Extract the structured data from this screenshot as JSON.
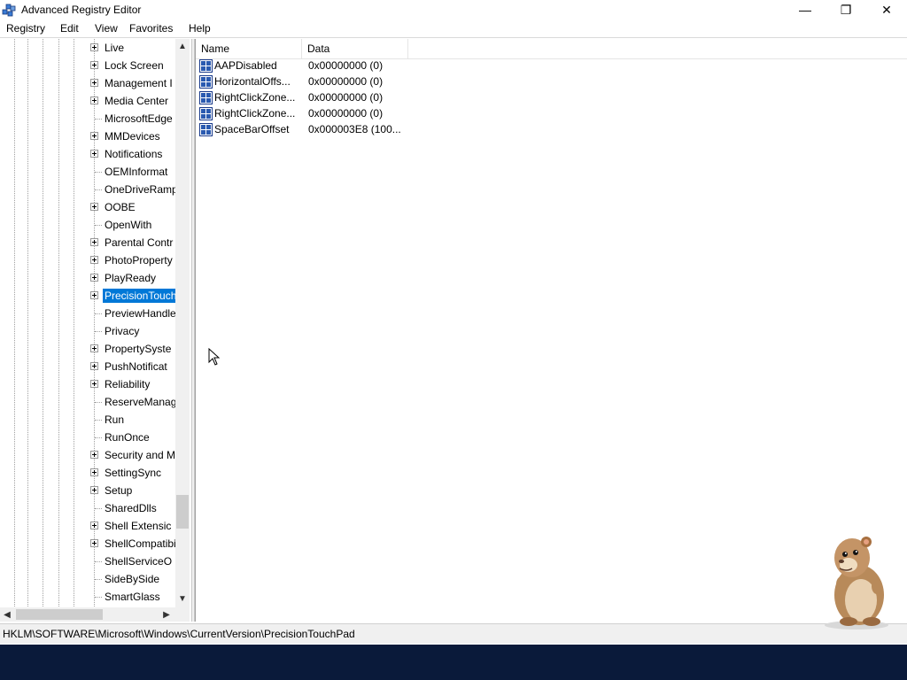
{
  "window": {
    "title": "Advanced Registry Editor",
    "controls": {
      "minimize": "—",
      "maximize": "❐",
      "close": "✕"
    }
  },
  "menu": [
    "Registry",
    "Edit",
    "View",
    "Favorites",
    "Help"
  ],
  "tree": {
    "items": [
      {
        "label": "Live",
        "expandable": true
      },
      {
        "label": "Lock Screen",
        "expandable": true
      },
      {
        "label": "Management I",
        "expandable": true
      },
      {
        "label": "Media Center",
        "expandable": true
      },
      {
        "label": "MicrosoftEdge",
        "expandable": false
      },
      {
        "label": "MMDevices",
        "expandable": true
      },
      {
        "label": "Notifications",
        "expandable": true
      },
      {
        "label": "OEMInformat",
        "expandable": false
      },
      {
        "label": "OneDriveRamp",
        "expandable": false
      },
      {
        "label": "OOBE",
        "expandable": true
      },
      {
        "label": "OpenWith",
        "expandable": false
      },
      {
        "label": "Parental Contr",
        "expandable": true
      },
      {
        "label": "PhotoProperty",
        "expandable": true
      },
      {
        "label": "PlayReady",
        "expandable": true
      },
      {
        "label": "PrecisionTouch",
        "expandable": true,
        "selected": true
      },
      {
        "label": "PreviewHandle",
        "expandable": false
      },
      {
        "label": "Privacy",
        "expandable": false
      },
      {
        "label": "PropertySyste",
        "expandable": true
      },
      {
        "label": "PushNotificat",
        "expandable": true
      },
      {
        "label": "Reliability",
        "expandable": true
      },
      {
        "label": "ReserveManage",
        "expandable": false
      },
      {
        "label": "Run",
        "expandable": false
      },
      {
        "label": "RunOnce",
        "expandable": false
      },
      {
        "label": "Security and M",
        "expandable": true
      },
      {
        "label": "SettingSync",
        "expandable": true
      },
      {
        "label": "Setup",
        "expandable": true
      },
      {
        "label": "SharedDlls",
        "expandable": false
      },
      {
        "label": "Shell Extensic",
        "expandable": true
      },
      {
        "label": "ShellCompatibi",
        "expandable": true
      },
      {
        "label": "ShellServiceO",
        "expandable": false
      },
      {
        "label": "SideBySide",
        "expandable": false
      },
      {
        "label": "SmartGlass",
        "expandable": false
      }
    ]
  },
  "list": {
    "columns": [
      "Name",
      "Data"
    ],
    "rows": [
      {
        "name": "AAPDisabled",
        "data": "0x00000000 (0)",
        "icon": "dword-value-icon"
      },
      {
        "name": "HorizontalOffs...",
        "data": "0x00000000 (0)",
        "icon": "dword-value-icon"
      },
      {
        "name": "RightClickZone...",
        "data": "0x00000000 (0)",
        "icon": "dword-value-icon"
      },
      {
        "name": "RightClickZone...",
        "data": "0x00000000 (0)",
        "icon": "dword-value-icon"
      },
      {
        "name": "SpaceBarOffset",
        "data": "0x000003E8 (100...",
        "icon": "dword-value-icon"
      }
    ]
  },
  "status": {
    "path": "HKLM\\SOFTWARE\\Microsoft\\Windows\\CurrentVersion\\PrecisionTouchPad"
  },
  "colors": {
    "selection": "#0078d7",
    "taskbar": "#0a1a3a"
  }
}
